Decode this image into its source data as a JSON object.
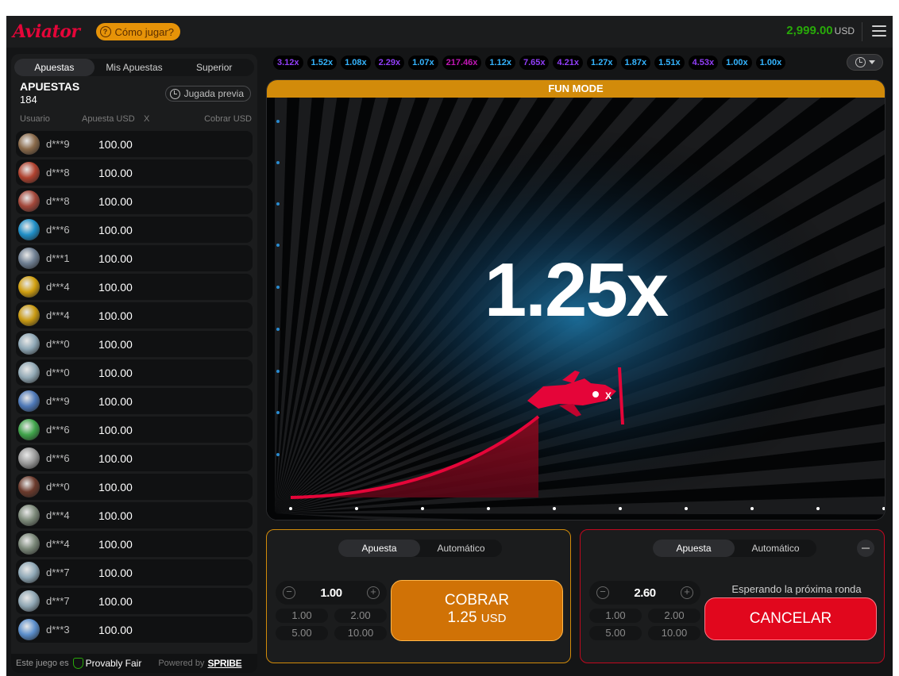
{
  "header": {
    "logo": "Aviator",
    "how_to_play": "Cómo jugar?",
    "balance": "2,999.00",
    "currency": "USD"
  },
  "left_panel": {
    "tabs": [
      {
        "label": "Apuestas",
        "active": true
      },
      {
        "label": "Mis Apuestas",
        "active": false
      },
      {
        "label": "Superior",
        "active": false
      }
    ],
    "bets_title": "APUESTAS",
    "bets_count": "184",
    "previous_button": "Jugada previa",
    "columns": {
      "user": "Usuario",
      "bet": "Apuesta USD",
      "x": "X",
      "cashout": "Cobrar USD"
    },
    "rows": [
      {
        "user": "d***9",
        "amount": "100.00",
        "avatar": "lion",
        "color": "#8a6a4a"
      },
      {
        "user": "d***8",
        "amount": "100.00",
        "avatar": "wings-red",
        "color": "#b0422f"
      },
      {
        "user": "d***8",
        "amount": "100.00",
        "avatar": "wings-red",
        "color": "#a3473a"
      },
      {
        "user": "d***6",
        "amount": "100.00",
        "avatar": "astronaut-orange",
        "color": "#1f8fc7"
      },
      {
        "user": "d***1",
        "amount": "100.00",
        "avatar": "plane-white",
        "color": "#6f7f92"
      },
      {
        "user": "d***4",
        "amount": "100.00",
        "avatar": "gold-wings",
        "color": "#d1a010"
      },
      {
        "user": "d***4",
        "amount": "100.00",
        "avatar": "gold-wings",
        "color": "#c99a12"
      },
      {
        "user": "d***0",
        "amount": "100.00",
        "avatar": "money",
        "color": "#8fa8b6"
      },
      {
        "user": "d***0",
        "amount": "100.00",
        "avatar": "money",
        "color": "#92a9b5"
      },
      {
        "user": "d***9",
        "amount": "100.00",
        "avatar": "plane-blue",
        "color": "#4e79b8"
      },
      {
        "user": "d***6",
        "amount": "100.00",
        "avatar": "clover",
        "color": "#3fa44a"
      },
      {
        "user": "d***6",
        "amount": "100.00",
        "avatar": "eagle",
        "color": "#9a9a9a"
      },
      {
        "user": "d***0",
        "amount": "100.00",
        "avatar": "pink-glasses",
        "color": "#6b3a2c"
      },
      {
        "user": "d***4",
        "amount": "100.00",
        "avatar": "plane-gray",
        "color": "#7d8a7a"
      },
      {
        "user": "d***4",
        "amount": "100.00",
        "avatar": "plane-gray",
        "color": "#7a8778"
      },
      {
        "user": "d***7",
        "amount": "100.00",
        "avatar": "money",
        "color": "#8fa8b6"
      },
      {
        "user": "d***7",
        "amount": "100.00",
        "avatar": "money",
        "color": "#90a7b4"
      },
      {
        "user": "d***3",
        "amount": "100.00",
        "avatar": "plane-red",
        "color": "#5b8ecb"
      }
    ],
    "footer": {
      "text": "Este juego es",
      "provably": "Provably Fair",
      "powered": "Powered by",
      "brand": "SPRIBE"
    }
  },
  "multipliers": [
    {
      "value": "3.12x",
      "color": "#913ef8"
    },
    {
      "value": "1.52x",
      "color": "#34b4ff"
    },
    {
      "value": "1.08x",
      "color": "#34b4ff"
    },
    {
      "value": "2.29x",
      "color": "#913ef8"
    },
    {
      "value": "1.07x",
      "color": "#34b4ff"
    },
    {
      "value": "217.46x",
      "color": "#c017b4"
    },
    {
      "value": "1.12x",
      "color": "#34b4ff"
    },
    {
      "value": "7.65x",
      "color": "#913ef8"
    },
    {
      "value": "4.21x",
      "color": "#913ef8"
    },
    {
      "value": "1.27x",
      "color": "#34b4ff"
    },
    {
      "value": "1.87x",
      "color": "#34b4ff"
    },
    {
      "value": "1.51x",
      "color": "#34b4ff"
    },
    {
      "value": "4.53x",
      "color": "#913ef8"
    },
    {
      "value": "1.00x",
      "color": "#34b4ff"
    },
    {
      "value": "1.00x",
      "color": "#34b4ff"
    }
  ],
  "game": {
    "mode_banner": "FUN MODE",
    "current_multiplier": "1.25x",
    "accent": "#e50539"
  },
  "bet_panels": [
    {
      "tabs": [
        "Apuesta",
        "Automático"
      ],
      "amount": "1.00",
      "chips": [
        "1.00",
        "2.00",
        "5.00",
        "10.00"
      ],
      "action_line1": "COBRAR",
      "action_amount": "1.25",
      "action_currency": "USD"
    },
    {
      "tabs": [
        "Apuesta",
        "Automático"
      ],
      "amount": "2.60",
      "chips": [
        "1.00",
        "2.00",
        "5.00",
        "10.00"
      ],
      "status": "Esperando la próxima ronda",
      "action_label": "CANCELAR"
    }
  ]
}
